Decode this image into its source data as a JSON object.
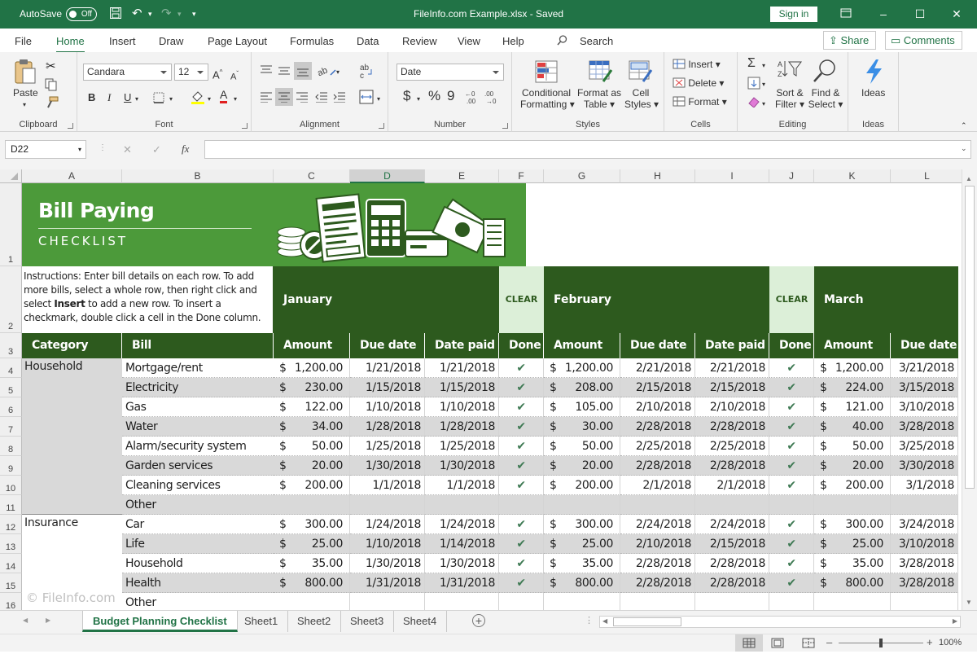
{
  "titlebar": {
    "autosave": "AutoSave",
    "toggle": "Off",
    "doc_title": "FileInfo.com Example.xlsx  -  Saved",
    "signin": "Sign in",
    "min": "–",
    "max": "☐",
    "close": "✕"
  },
  "tabs": [
    "File",
    "Home",
    "Insert",
    "Draw",
    "Page Layout",
    "Formulas",
    "Data",
    "Review",
    "View",
    "Help"
  ],
  "search_label": "Search",
  "share": "Share",
  "comments": "Comments",
  "ribbon": {
    "clipboard": {
      "paste": "Paste",
      "label": "Clipboard"
    },
    "font": {
      "name": "Candara",
      "size": "12",
      "label": "Font",
      "grow": "A",
      "shrink": "A",
      "bold": "B",
      "italic": "I",
      "underline": "U",
      "fontcolor": "A"
    },
    "alignment": {
      "label": "Alignment"
    },
    "number": {
      "format": "Date",
      "label": "Number",
      "currency": "$",
      "percent": "%",
      "comma": "9"
    },
    "styles": {
      "conditional": "Conditional",
      "conditional2": "Formatting",
      "format_as": "Format as",
      "format_as2": "Table",
      "cell": "Cell",
      "cell2": "Styles",
      "label": "Styles"
    },
    "cells": {
      "insert": "Insert",
      "delete": "Delete",
      "format": "Format",
      "label": "Cells"
    },
    "editing": {
      "sort": "Sort &",
      "sort2": "Filter",
      "find": "Find &",
      "find2": "Select",
      "label": "Editing",
      "sum": "Σ"
    },
    "ideas": {
      "btn": "Ideas",
      "label": "Ideas"
    }
  },
  "formula_bar": {
    "namebox": "D22",
    "fx": "fx",
    "cancel": "✕",
    "enter": "✓"
  },
  "columns": [
    "A",
    "B",
    "C",
    "D",
    "E",
    "F",
    "G",
    "H",
    "I",
    "J",
    "K",
    "L"
  ],
  "rows": [
    "1",
    "2",
    "3",
    "4",
    "5",
    "6",
    "7",
    "8",
    "9",
    "10",
    "11",
    "12",
    "13",
    "14",
    "15",
    "16"
  ],
  "banner": {
    "title": "Bill Paying",
    "subtitle": "CHECKLIST"
  },
  "instructions": {
    "a": "Instructions: Enter bill details on each row. To add more bills, select a whole row, then right click and select ",
    "b": "Insert",
    "c": " to add a new row. To insert a checkmark, double click a cell in the Done column."
  },
  "months": [
    "January",
    "February",
    "March"
  ],
  "clear": "CLEAR",
  "headers": {
    "category": "Category",
    "bill": "Bill",
    "amount": "Amount",
    "due": "Due date",
    "paid": "Date paid",
    "done": "Done"
  },
  "categories": [
    "Household",
    "Insurance"
  ],
  "bills": [
    {
      "bill": "Mortgage/rent",
      "jan": [
        "1,200.00",
        "1/21/2018",
        "1/21/2018"
      ],
      "feb": [
        "1,200.00",
        "2/21/2018",
        "2/21/2018"
      ],
      "mar": [
        "1,200.00",
        "3/21/2018"
      ],
      "done": true
    },
    {
      "bill": "Electricity",
      "jan": [
        "230.00",
        "1/15/2018",
        "1/15/2018"
      ],
      "feb": [
        "208.00",
        "2/15/2018",
        "2/15/2018"
      ],
      "mar": [
        "224.00",
        "3/15/2018"
      ],
      "done": true
    },
    {
      "bill": "Gas",
      "jan": [
        "122.00",
        "1/10/2018",
        "1/10/2018"
      ],
      "feb": [
        "105.00",
        "2/10/2018",
        "2/10/2018"
      ],
      "mar": [
        "121.00",
        "3/10/2018"
      ],
      "done": true
    },
    {
      "bill": "Water",
      "jan": [
        "34.00",
        "1/28/2018",
        "1/28/2018"
      ],
      "feb": [
        "30.00",
        "2/28/2018",
        "2/28/2018"
      ],
      "mar": [
        "40.00",
        "3/28/2018"
      ],
      "done": true
    },
    {
      "bill": "Alarm/security system",
      "jan": [
        "50.00",
        "1/25/2018",
        "1/25/2018"
      ],
      "feb": [
        "50.00",
        "2/25/2018",
        "2/25/2018"
      ],
      "mar": [
        "50.00",
        "3/25/2018"
      ],
      "done": true
    },
    {
      "bill": "Garden services",
      "jan": [
        "20.00",
        "1/30/2018",
        "1/30/2018"
      ],
      "feb": [
        "20.00",
        "2/28/2018",
        "2/28/2018"
      ],
      "mar": [
        "20.00",
        "3/30/2018"
      ],
      "done": true
    },
    {
      "bill": "Cleaning services",
      "jan": [
        "200.00",
        "1/1/2018",
        "1/1/2018"
      ],
      "feb": [
        "200.00",
        "2/1/2018",
        "2/1/2018"
      ],
      "mar": [
        "200.00",
        "3/1/2018"
      ],
      "done": true
    },
    {
      "bill": "Other",
      "jan": [
        "",
        "",
        ""
      ],
      "feb": [
        "",
        "",
        ""
      ],
      "mar": [
        "",
        ""
      ],
      "done": false
    },
    {
      "bill": "Car",
      "jan": [
        "300.00",
        "1/24/2018",
        "1/24/2018"
      ],
      "feb": [
        "300.00",
        "2/24/2018",
        "2/24/2018"
      ],
      "mar": [
        "300.00",
        "3/24/2018"
      ],
      "done": true
    },
    {
      "bill": "Life",
      "jan": [
        "25.00",
        "1/10/2018",
        "1/14/2018"
      ],
      "feb": [
        "25.00",
        "2/10/2018",
        "2/15/2018"
      ],
      "mar": [
        "25.00",
        "3/10/2018"
      ],
      "done": true
    },
    {
      "bill": "Household",
      "jan": [
        "35.00",
        "1/30/2018",
        "1/30/2018"
      ],
      "feb": [
        "35.00",
        "2/28/2018",
        "2/28/2018"
      ],
      "mar": [
        "35.00",
        "3/28/2018"
      ],
      "done": true
    },
    {
      "bill": "Health",
      "jan": [
        "800.00",
        "1/31/2018",
        "1/31/2018"
      ],
      "feb": [
        "800.00",
        "2/28/2018",
        "2/28/2018"
      ],
      "mar": [
        "800.00",
        "3/28/2018"
      ],
      "done": true
    },
    {
      "bill": "Other",
      "jan": [
        "",
        "",
        ""
      ],
      "feb": [
        "",
        "",
        ""
      ],
      "mar": [
        "",
        ""
      ],
      "done": false
    }
  ],
  "currency": "$",
  "check": "✔",
  "watermark": "© FileInfo.com",
  "sheets": [
    "Budget Planning Checklist",
    "Sheet1",
    "Sheet2",
    "Sheet3",
    "Sheet4"
  ],
  "add_sheet": "+",
  "status": {
    "zoom": "100%",
    "minus": "–",
    "plus": "+"
  },
  "colors": {
    "accent": "#217346",
    "header_green": "#2d5a1e",
    "banner_green": "#4c9a3a",
    "clear_bg": "#dcefd8"
  }
}
